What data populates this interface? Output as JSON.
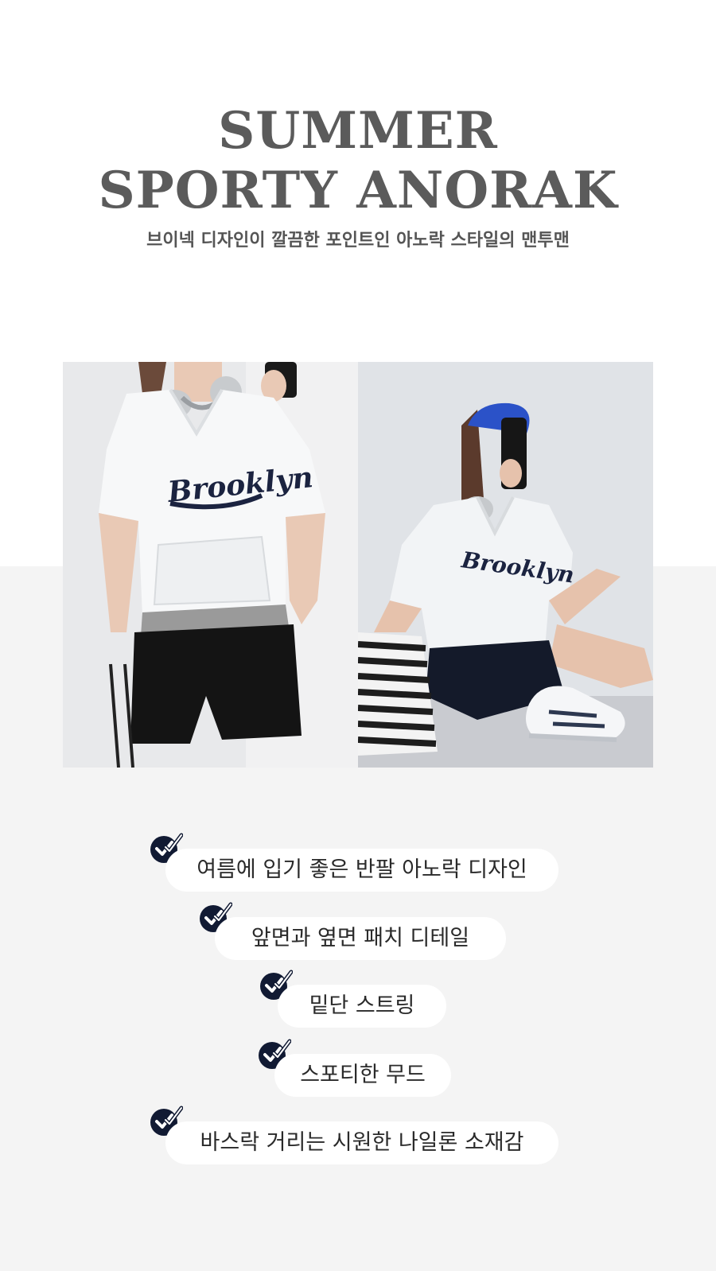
{
  "header": {
    "title_line1": "SUMMER",
    "title_line2": "SPORTY ANORAK",
    "subtitle": "브이넥 디자인이 깔끔한 포인트인 아노락 스타일의 맨투맨"
  },
  "photos": [
    {
      "id": "left",
      "shirt_text": "Brooklyn"
    },
    {
      "id": "right",
      "shirt_text": "Brooklyn"
    }
  ],
  "features": [
    "여름에 입기 좋은 반팔 아노락 디자인",
    "앞면과 옆면 패치 디테일",
    "밑단 스트링",
    "스포티한 무드",
    "바스락 거리는 시원한 나일론 소재감"
  ],
  "colors": {
    "title": "#5b5b5b",
    "check_badge": "#111a33",
    "section_bg": "#f4f4f4",
    "pill_bg": "#ffffff"
  }
}
